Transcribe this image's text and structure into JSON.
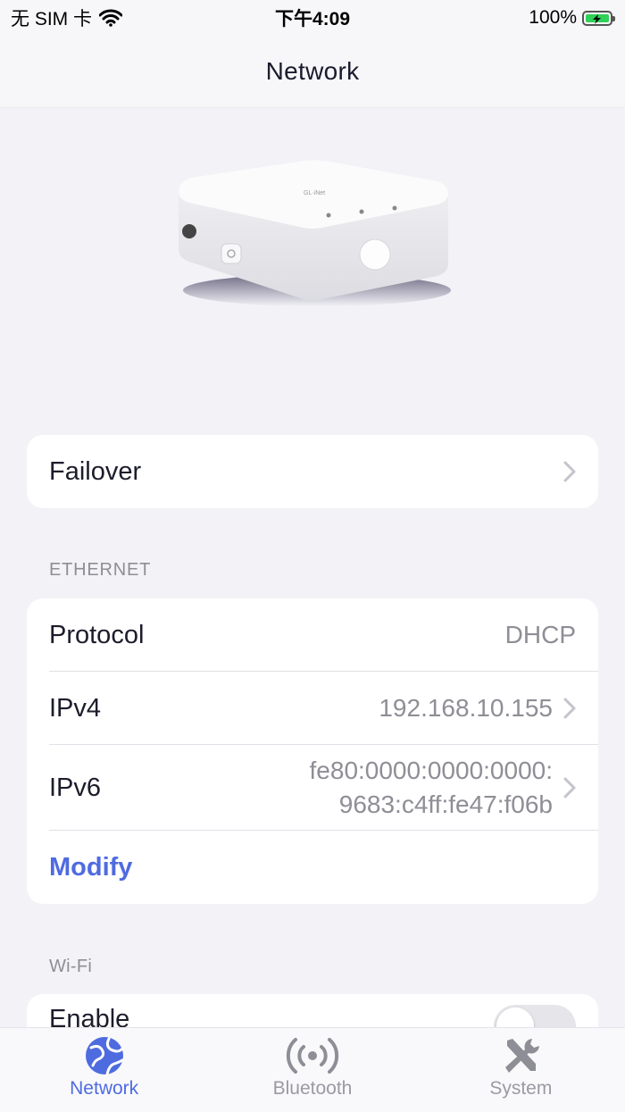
{
  "status_bar": {
    "carrier": "无 SIM 卡",
    "time": "下午4:09",
    "battery_percent": "100%",
    "battery_level": 1.0
  },
  "nav": {
    "title": "Network"
  },
  "failover": {
    "label": "Failover"
  },
  "ethernet": {
    "header": "ETHERNET",
    "protocol_label": "Protocol",
    "protocol_value": "DHCP",
    "ipv4_label": "IPv4",
    "ipv4_value": "192.168.10.155",
    "ipv6_label": "IPv6",
    "ipv6_value_line1": "fe80:0000:0000:0000:",
    "ipv6_value_line2": "9683:c4ff:fe47:f06b",
    "modify_label": "Modify"
  },
  "wifi": {
    "header": "Wi-Fi",
    "enable_label": "Enable",
    "enabled": false
  },
  "tabs": [
    {
      "label": "Network",
      "icon": "globe-icon",
      "active": true
    },
    {
      "label": "Bluetooth",
      "icon": "broadcast-icon",
      "active": false
    },
    {
      "label": "System",
      "icon": "tools-icon",
      "active": false
    }
  ],
  "colors": {
    "accent": "#4f6be0",
    "background": "#f2f2f7",
    "secondary_text": "#8e8e96",
    "battery": "#2fd158"
  }
}
